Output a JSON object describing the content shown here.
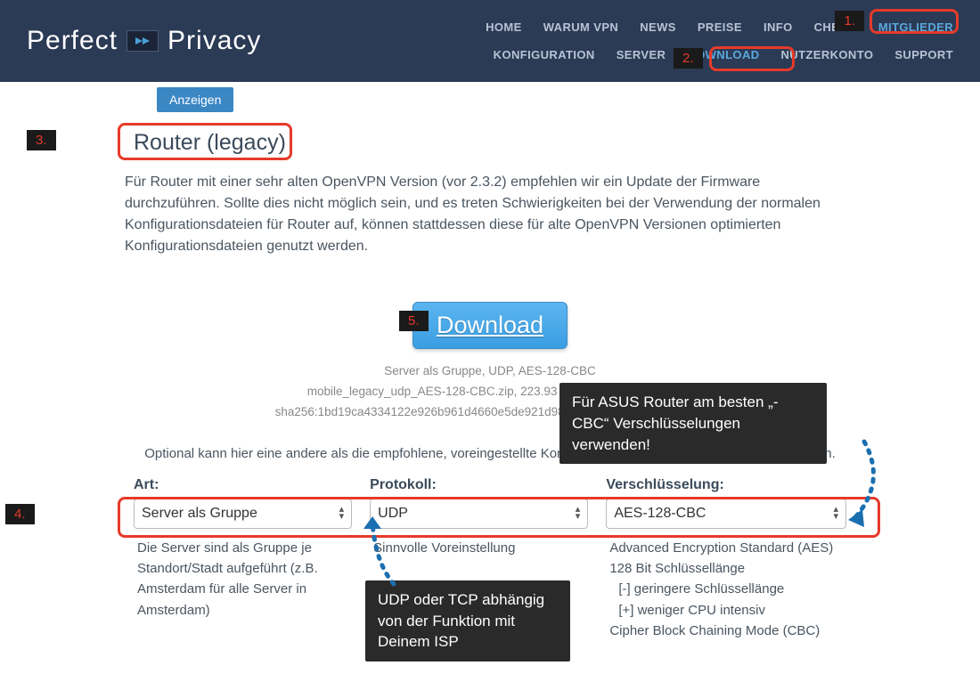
{
  "logo": {
    "left": "Perfect",
    "right": "Privacy"
  },
  "nav1": {
    "home": "HOME",
    "warum": "WARUM VPN",
    "news": "NEWS",
    "preise": "PREISE",
    "info": "INFO",
    "check": "CHECK",
    "mitglieder": "MITGLIEDER"
  },
  "nav2": {
    "konfig": "KONFIGURATION",
    "server": "SERVER",
    "download": "DOWNLOAD",
    "nutzer": "NUTZERKONTO",
    "support": "SUPPORT"
  },
  "anzeigen": "Anzeigen",
  "section_title": "Router (legacy)",
  "paragraph": "Für Router mit einer sehr alten OpenVPN Version (vor 2.3.2) empfehlen wir ein Update der Firmware durchzuführen. Sollte dies nicht möglich sein, und es treten Schwierigkeiten bei der Verwendung der normalen Konfigurationsdateien für Router auf, können stattdessen diese für alte OpenVPN Versionen optimierten Konfigurationsdateien genutzt werden.",
  "download": "Download",
  "meta": {
    "l1": "Server als Gruppe, UDP, AES-128-CBC",
    "l2": "mobile_legacy_udp_AES-128-CBC.zip, 223.93 KB, 2017-10-01 UTC",
    "l3": "sha256:1bd19ca4334122e926b961d4660e5de921d98955a828a8bd9e03e44339"
  },
  "optional": "Optional kann hier eine andere als die empfohlene, voreingestellte Konfiguration zum herunterladen gewählt werden.",
  "cols": {
    "art": {
      "label": "Art:",
      "value": "Server als Gruppe",
      "desc": "Die Server sind als Gruppe je Standort/Stadt aufgeführt (z.B. Amsterdam für alle Server in Amsterdam)"
    },
    "proto": {
      "label": "Protokoll:",
      "value": "UDP",
      "desc": "Sinnvolle Voreinstellung"
    },
    "enc": {
      "label": "Verschlüsselung:",
      "value": "AES-128-CBC",
      "d1": "Advanced Encryption Standard (AES)",
      "d2": "128 Bit Schlüssellänge",
      "d3": "[-] geringere Schlüssellänge",
      "d4": "[+] weniger CPU intensiv",
      "d5": "Cipher Block Chaining Mode (CBC)"
    }
  },
  "callouts": {
    "asus": "Für ASUS Router am besten „-CBC“ Verschlüsselungen verwenden!",
    "udp": "UDP oder TCP abhängig von der Funktion mit Deinem ISP"
  },
  "steps": {
    "s1": "1.",
    "s2": "2.",
    "s3": "3.",
    "s4": "4.",
    "s5": "5."
  }
}
